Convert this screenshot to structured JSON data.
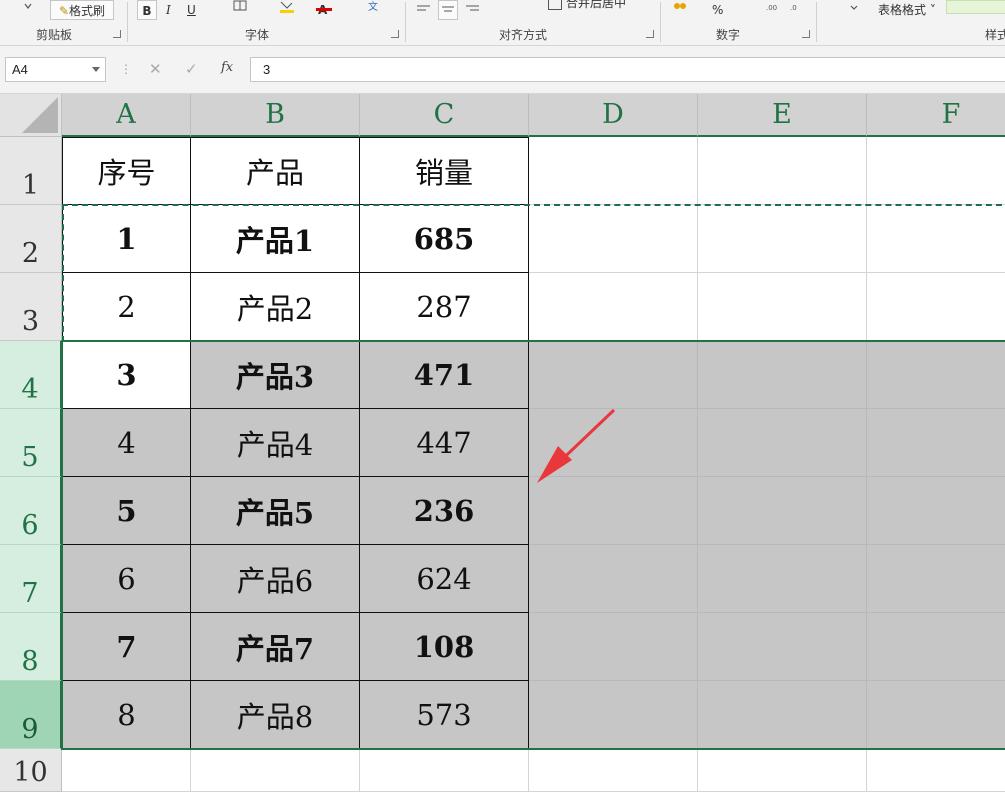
{
  "ribbon": {
    "format_painter_label": "格式刷",
    "bold_label": "B",
    "italic_label": "I",
    "underline_label": "U",
    "font_color_label": "A",
    "merge_center_label": "合并后居中",
    "percent_label": "%",
    "table_format_label": "表格格式",
    "groups": {
      "clipboard": "剪贴板",
      "font": "字体",
      "alignment": "对齐方式",
      "number": "数字",
      "styles": "样式"
    }
  },
  "formula_bar": {
    "name_box": "A4",
    "cancel_glyph": "✕",
    "enter_glyph": "✓",
    "fx_label": "fx",
    "value": "3"
  },
  "columns": [
    "A",
    "B",
    "C",
    "D",
    "E",
    "F"
  ],
  "rows": [
    "1",
    "2",
    "3",
    "4",
    "5",
    "6",
    "7",
    "8",
    "9",
    "10"
  ],
  "table": {
    "headers": [
      "序号",
      "产品",
      "销量"
    ],
    "rows": [
      [
        "1",
        "产品1",
        "685"
      ],
      [
        "2",
        "产品2",
        "287"
      ],
      [
        "3",
        "产品3",
        "471"
      ],
      [
        "4",
        "产品4",
        "447"
      ],
      [
        "5",
        "产品5",
        "236"
      ],
      [
        "6",
        "产品6",
        "624"
      ],
      [
        "7",
        "产品7",
        "108"
      ],
      [
        "8",
        "产品8",
        "573"
      ]
    ],
    "bold_rows": [
      0,
      2,
      4,
      6
    ]
  },
  "colors": {
    "excel_green": "#217346",
    "annotation_arrow": "#e8383b"
  }
}
